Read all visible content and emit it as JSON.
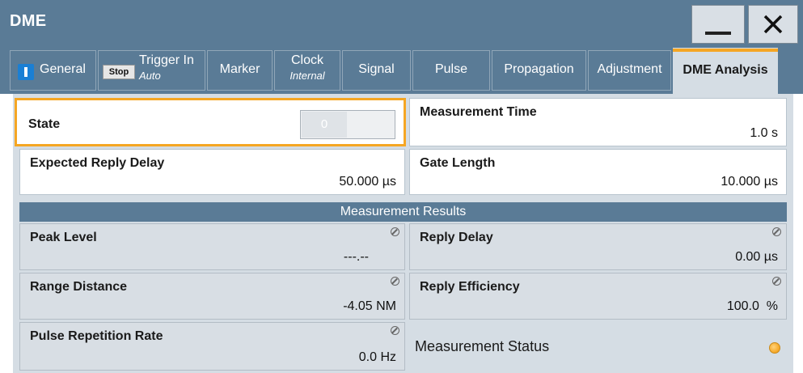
{
  "window": {
    "title": "DME",
    "minimize_label": "_",
    "close_label": "✕"
  },
  "tabs": [
    {
      "label": "General",
      "icon": "toggle-on-icon"
    },
    {
      "label": "Trigger In",
      "sub": "Auto",
      "badge": "Stop"
    },
    {
      "label": "Marker"
    },
    {
      "label": "Clock",
      "sub": "Internal"
    },
    {
      "label": "Signal"
    },
    {
      "label": "Pulse"
    },
    {
      "label": "Propagation"
    },
    {
      "label": "Adjustment"
    },
    {
      "label": "DME Analysis",
      "active": true
    }
  ],
  "settings": {
    "state": {
      "label": "State",
      "value": "0"
    },
    "measurement_time": {
      "label": "Measurement Time",
      "value": "1.0 s"
    },
    "expected_reply_delay": {
      "label": "Expected Reply Delay",
      "value": "50.000 µs"
    },
    "gate_length": {
      "label": "Gate Length",
      "value": "10.000 µs"
    }
  },
  "results": {
    "header": "Measurement Results",
    "peak_level": {
      "label": "Peak Level",
      "value": "---.--"
    },
    "reply_delay": {
      "label": "Reply Delay",
      "value": "0.00 µs"
    },
    "range_distance": {
      "label": "Range Distance",
      "value": "-4.05 NM"
    },
    "reply_efficiency": {
      "label": "Reply Efficiency",
      "value": "100.0  %"
    },
    "pulse_repetition_rate": {
      "label": "Pulse Repetition Rate",
      "value": "0.0 Hz"
    },
    "measurement_status": {
      "label": "Measurement Status",
      "led_color": "#f5a623"
    }
  },
  "colors": {
    "titlebar": "#5a7b96",
    "panel": "#d5dde4",
    "accent": "#f5a623",
    "toggle": "#1a7fd4"
  }
}
